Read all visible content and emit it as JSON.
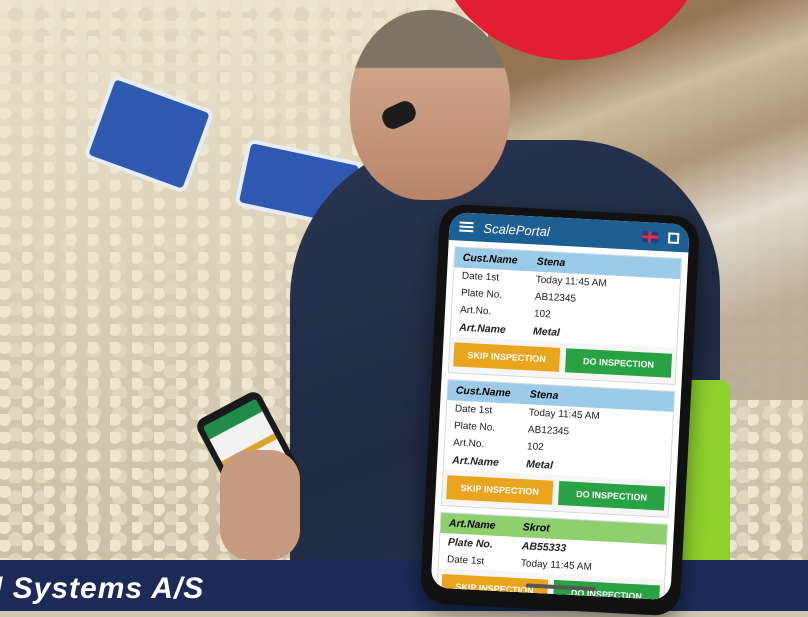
{
  "app": {
    "title": "ScalePortal",
    "language_flag": "uk-flag-icon",
    "menu_icon": "menu-icon",
    "grid_icon": "grid-icon"
  },
  "cards": [
    {
      "header": {
        "k": "Cust.Name",
        "v": "Stena"
      },
      "rows": [
        {
          "k": "Date 1st",
          "v": "Today 11:45 AM"
        },
        {
          "k": "Plate No.",
          "v": "AB12345"
        },
        {
          "k": "Art.No.",
          "v": "102"
        },
        {
          "k": "Art.Name",
          "v": "Metal",
          "bold": true
        }
      ],
      "skip_label": "SKIP INSPECTION",
      "do_label": "DO INSPECTION"
    },
    {
      "header": {
        "k": "Cust.Name",
        "v": "Stena"
      },
      "rows": [
        {
          "k": "Date 1st",
          "v": "Today 11:45 AM"
        },
        {
          "k": "Plate No.",
          "v": "AB12345"
        },
        {
          "k": "Art.No.",
          "v": "102"
        },
        {
          "k": "Art.Name",
          "v": "Metal",
          "bold": true
        }
      ],
      "skip_label": "SKIP INSPECTION",
      "do_label": "DO INSPECTION"
    },
    {
      "header": {
        "k": "Art.Name",
        "v": "Skrot",
        "color": "green"
      },
      "rows": [
        {
          "k": "Plate No.",
          "v": "AB55333",
          "bold": true
        },
        {
          "k": "Date 1st",
          "v": "Today 11:45 AM"
        }
      ],
      "skip_label": "SKIP INSPECTION",
      "do_label": "DO INSPECTION"
    }
  ],
  "footer": {
    "text": "l Systems A/S"
  },
  "colors": {
    "app_bar": "#1d5f93",
    "skip": "#eaa51f",
    "do": "#28a245",
    "brand_red": "#e21f32",
    "footer_bg": "#1b2a57"
  }
}
